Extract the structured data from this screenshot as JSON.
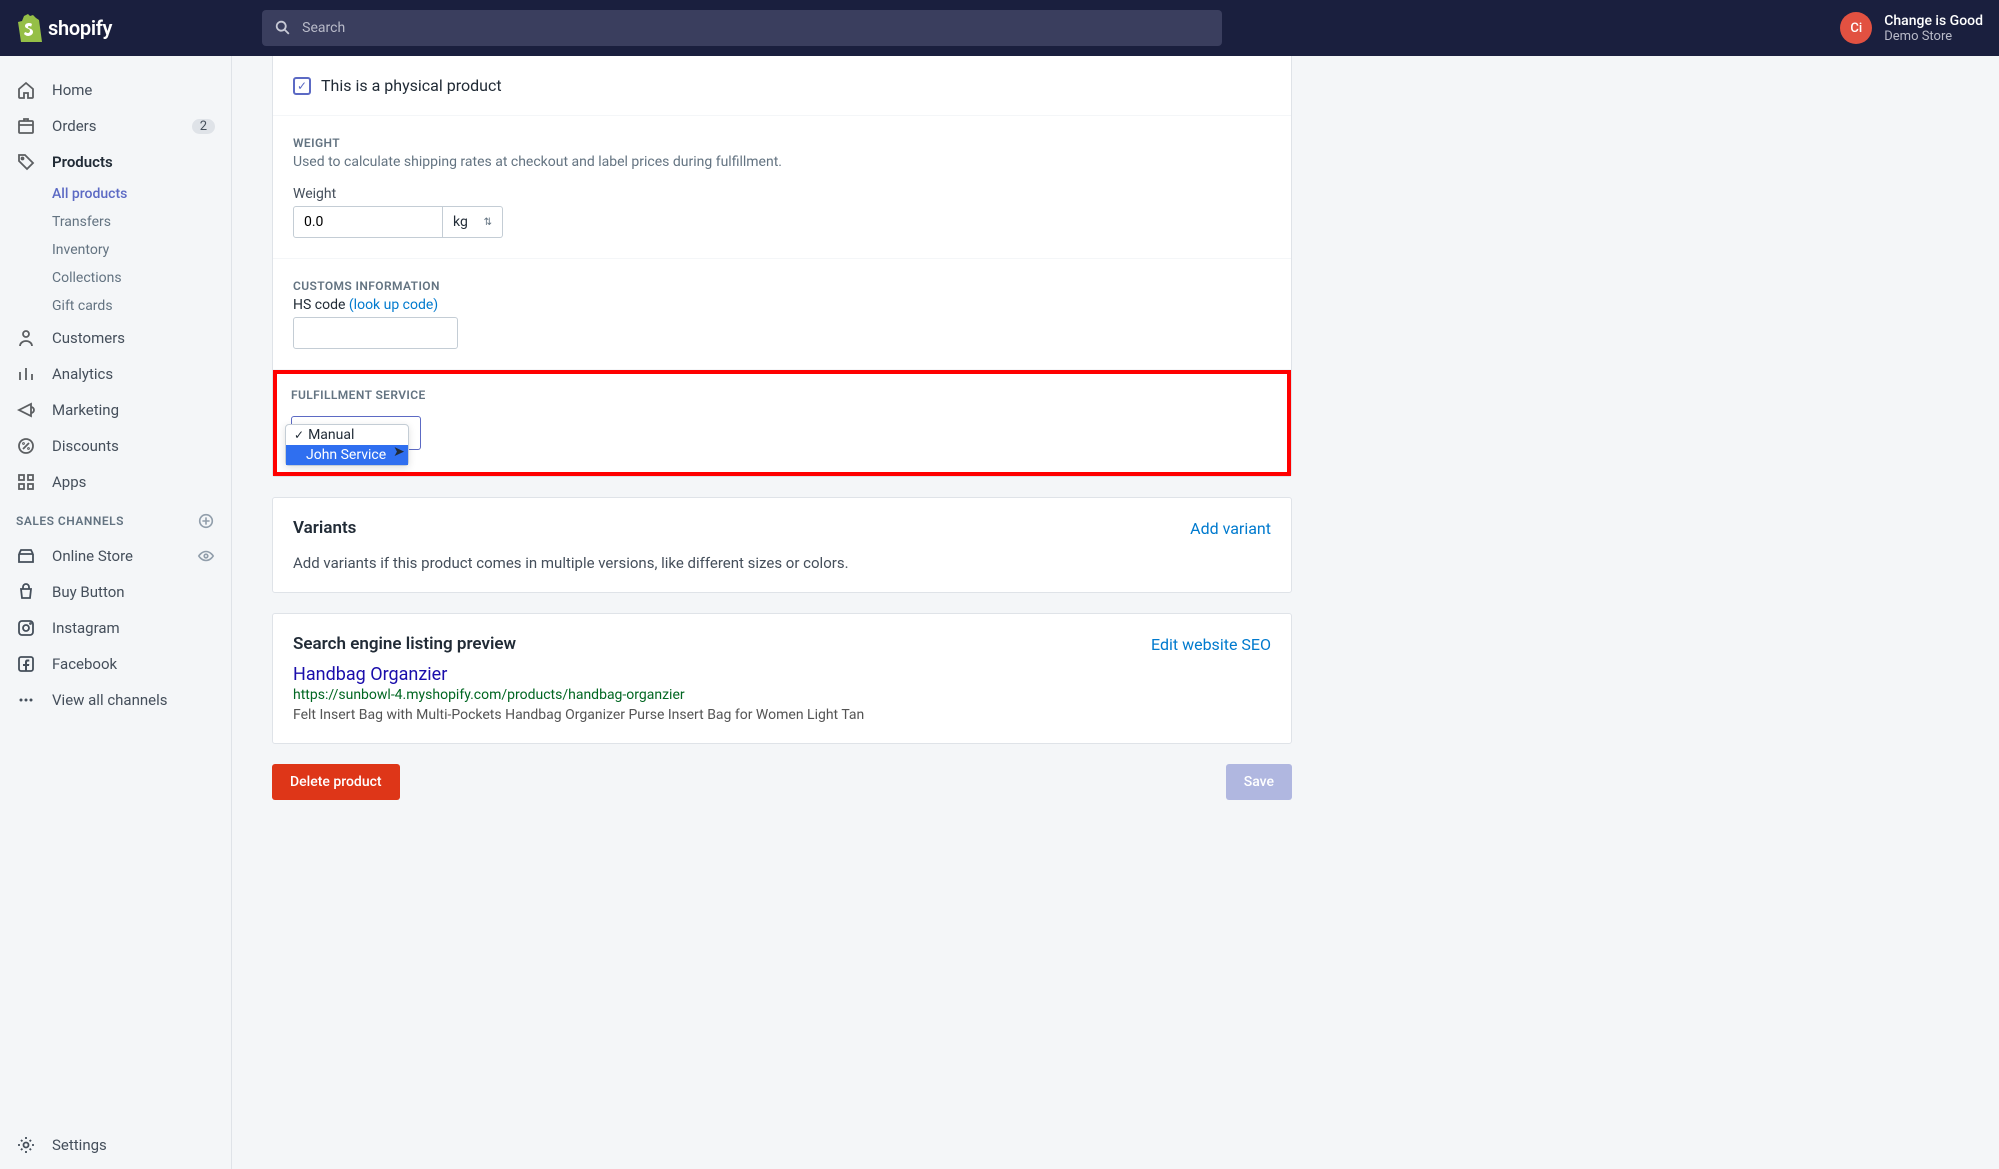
{
  "header": {
    "brand": "shopify",
    "search_placeholder": "Search",
    "user_initials": "Ci",
    "user_name": "Change is Good",
    "user_store": "Demo Store"
  },
  "sidebar": {
    "items": [
      {
        "label": "Home"
      },
      {
        "label": "Orders",
        "badge": "2"
      },
      {
        "label": "Products",
        "active": true
      },
      {
        "label": "Customers"
      },
      {
        "label": "Analytics"
      },
      {
        "label": "Marketing"
      },
      {
        "label": "Discounts"
      },
      {
        "label": "Apps"
      }
    ],
    "product_sub": [
      {
        "label": "All products",
        "active": true
      },
      {
        "label": "Transfers"
      },
      {
        "label": "Inventory"
      },
      {
        "label": "Collections"
      },
      {
        "label": "Gift cards"
      }
    ],
    "channels_header": "SALES CHANNELS",
    "channels": [
      {
        "label": "Online Store",
        "eye": true
      },
      {
        "label": "Buy Button"
      },
      {
        "label": "Instagram"
      },
      {
        "label": "Facebook"
      }
    ],
    "view_all": "View all channels",
    "settings": "Settings"
  },
  "shipping": {
    "physical_label": "This is a physical product",
    "weight_header": "WEIGHT",
    "weight_help": "Used to calculate shipping rates at checkout and label prices during fulfillment.",
    "weight_field_label": "Weight",
    "weight_value": "0.0",
    "weight_unit": "kg",
    "customs_header": "CUSTOMS INFORMATION",
    "hs_label": "HS code",
    "hs_link": "(look up code)",
    "fulfillment_header": "FULFILLMENT SERVICE",
    "fulfillment_options": [
      "Manual",
      "John Service"
    ],
    "fulfillment_selected": "Manual",
    "fulfillment_highlighted": "John Service"
  },
  "variants": {
    "title": "Variants",
    "add_link": "Add variant",
    "help": "Add variants if this product comes in multiple versions, like different sizes or colors."
  },
  "seo": {
    "title": "Search engine listing preview",
    "edit_link": "Edit website SEO",
    "preview_title": "Handbag Organzier",
    "preview_url": "https://sunbowl-4.myshopify.com/products/handbag-organzier",
    "preview_desc": "Felt Insert Bag with Multi-Pockets Handbag Organizer Purse Insert Bag for Women Light Tan"
  },
  "actions": {
    "delete": "Delete product",
    "save": "Save"
  }
}
